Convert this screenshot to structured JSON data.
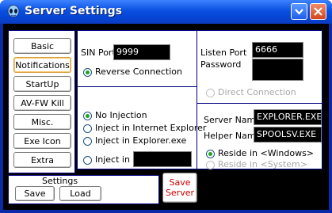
{
  "window": {
    "title": "Server Settings"
  },
  "nav": {
    "items": [
      {
        "label": "Basic"
      },
      {
        "label": "Notifications"
      },
      {
        "label": "StartUp"
      },
      {
        "label": "AV-FW Kill"
      },
      {
        "label": "Misc."
      },
      {
        "label": "Exe Icon"
      },
      {
        "label": "Extra"
      }
    ]
  },
  "settings": {
    "label": "Settings",
    "save": "Save",
    "load": "Load"
  },
  "save_server": {
    "line1": "Save",
    "line2": "Server"
  },
  "sin": {
    "label": "SIN Port",
    "value": "9999",
    "reverse_connection": "Reverse Connection"
  },
  "listen": {
    "port_label": "Listen Port",
    "port_value": "6666",
    "password_label": "Password",
    "password_value": "",
    "direct_connection": "Direct Connection"
  },
  "injection": {
    "no_injection": "No Injection",
    "inject_ie": "Inject in Internet Explorer",
    "inject_explorer": "Inject in Explorer.exe",
    "inject_in": "Inject in",
    "inject_in_value": ""
  },
  "server": {
    "name_label": "Server Name",
    "name_value": "EXPLORER.EXE",
    "helper_label": "Helper Name",
    "helper_value": "SPOOLSV.EXE",
    "reside_windows": "Reside in <Windows>",
    "reside_system": "Reside in <System>"
  },
  "colors": {
    "title_bar": "#0a4fe0",
    "window_frame": "#0a2aa8",
    "radio_checked": "#21a121",
    "save_server_text": "#cc0000"
  }
}
